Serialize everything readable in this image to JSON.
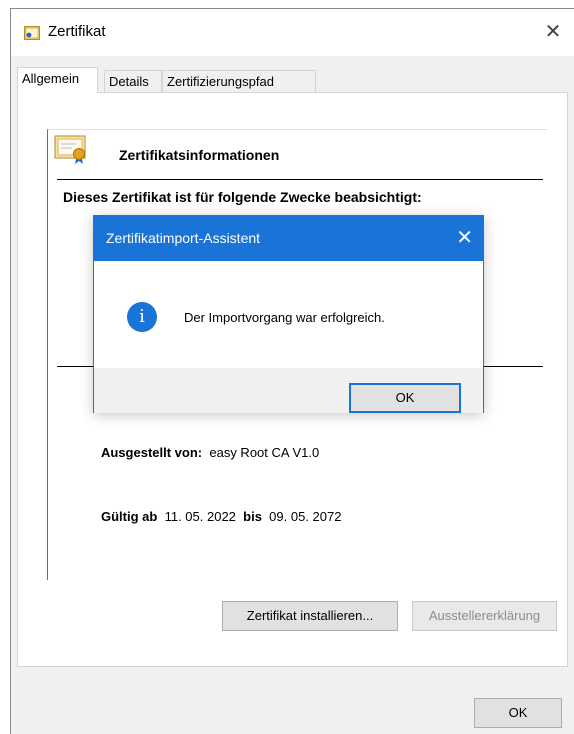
{
  "window": {
    "title": "Zertifikat",
    "close_glyph": "✕"
  },
  "tabs": [
    {
      "label": "Allgemein",
      "active": true
    },
    {
      "label": "Details",
      "active": false
    },
    {
      "label": "Zertifizierungspfad",
      "active": false
    }
  ],
  "info": {
    "heading": "Zertifikatsinformationen",
    "purpose_heading": "Dieses Zertifikat ist für folgende Zwecke beabsichtigt:",
    "issuer_label": "Ausgestellt von:",
    "issuer_value": "easy Root CA V1.0",
    "valid_from_label": "Gültig ab",
    "valid_from": "11. 05. 2022",
    "valid_to_label": "bis",
    "valid_to": "09. 05. 2072"
  },
  "buttons": {
    "install": "Zertifikat installieren...",
    "issuer_statement": "Ausstellererklärung",
    "ok": "OK"
  },
  "modal": {
    "title": "Zertifikatimport-Assistent",
    "close_glyph": "✕",
    "icon_glyph": "i",
    "message": "Der Importvorgang war erfolgreich.",
    "ok": "OK"
  },
  "colors": {
    "accent": "#1a73d6",
    "dialog_bg": "#f0f0f0"
  }
}
